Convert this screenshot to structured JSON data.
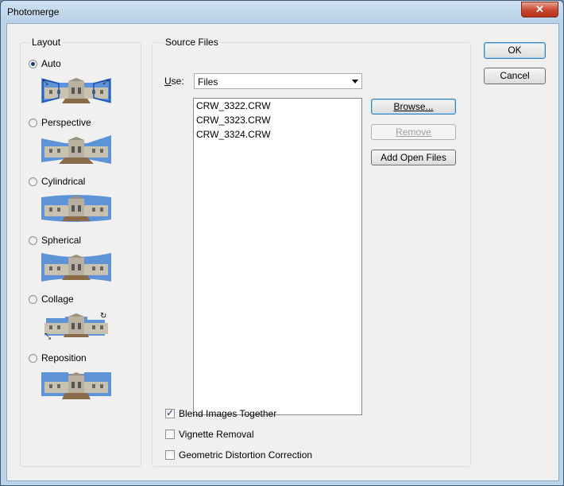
{
  "window": {
    "title": "Photomerge",
    "close_glyph": "✕"
  },
  "layout_group": {
    "legend": "Layout",
    "options": [
      {
        "label": "Auto",
        "selected": true,
        "icon": "auto-layout-icon"
      },
      {
        "label": "Perspective",
        "selected": false,
        "icon": "perspective-layout-icon"
      },
      {
        "label": "Cylindrical",
        "selected": false,
        "icon": "cylindrical-layout-icon"
      },
      {
        "label": "Spherical",
        "selected": false,
        "icon": "spherical-layout-icon"
      },
      {
        "label": "Collage",
        "selected": false,
        "icon": "collage-layout-icon"
      },
      {
        "label": "Reposition",
        "selected": false,
        "icon": "reposition-layout-icon"
      }
    ]
  },
  "source_group": {
    "legend": "Source Files",
    "use_label": "Use:",
    "use_value": "Files",
    "files": [
      "CRW_3322.CRW",
      "CRW_3323.CRW",
      "CRW_3324.CRW"
    ],
    "browse_label": "Browse...",
    "remove_label": "Remove",
    "add_open_label": "Add Open Files",
    "options": [
      {
        "label": "Blend Images Together",
        "checked": true
      },
      {
        "label": "Vignette Removal",
        "checked": false
      },
      {
        "label": "Geometric Distortion Correction",
        "checked": false
      }
    ]
  },
  "buttons": {
    "ok": "OK",
    "cancel": "Cancel"
  },
  "colors": {
    "sky": "#5e93d8",
    "building": "#c9c2b1",
    "ground": "#8a6a48",
    "accent": "#1f3b78"
  }
}
